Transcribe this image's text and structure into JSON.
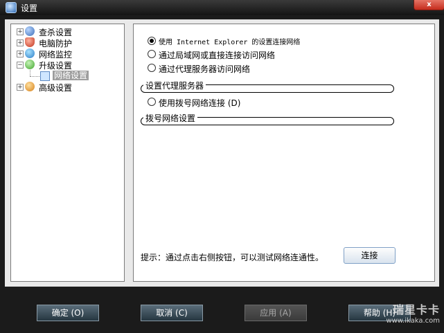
{
  "window": {
    "title": "设置",
    "close_label": "x"
  },
  "tree": {
    "items": [
      {
        "label": "查杀设置",
        "icon": "scan-icon"
      },
      {
        "label": "电脑防护",
        "icon": "shield-icon"
      },
      {
        "label": "网络监控",
        "icon": "network-monitor-icon"
      },
      {
        "label": "升级设置",
        "icon": "upgrade-icon",
        "expanded": true,
        "children": [
          {
            "label": "网络设置",
            "selected": true
          }
        ]
      },
      {
        "label": "高级设置",
        "icon": "advanced-icon"
      }
    ]
  },
  "content": {
    "radio_ie": "使用 Internet Explorer 的设置连接网络",
    "radio_lan": "通过局域网或直接连接访问网络",
    "radio_proxy": "通过代理服务器访问网络",
    "group_proxy": "设置代理服务器",
    "radio_dialup": "使用拨号网络连接 (D)",
    "group_dialup": "拨号网络设置",
    "hint": "提示：通过点击右侧按钮，可以测试网络连通性。",
    "connect_button": "连接"
  },
  "buttons": {
    "ok": "确定 (O)",
    "cancel": "取消 (C)",
    "apply": "应用 (A)",
    "help": "帮助 (H)"
  },
  "watermark": {
    "brand": "瑞星卡卡",
    "url": "www.ikaka.com"
  }
}
